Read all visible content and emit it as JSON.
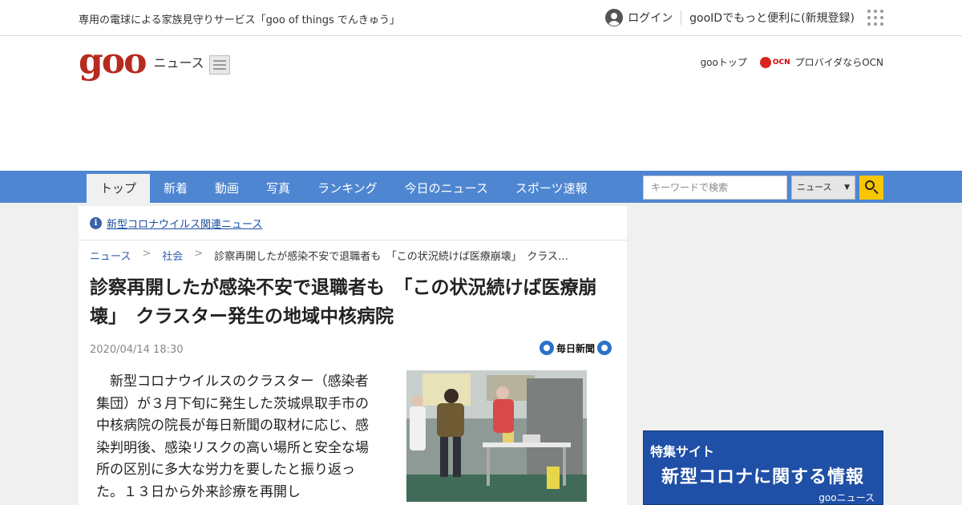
{
  "topbar": {
    "promo": "専用の電球による家族見守りサービス「goo of things でんきゅう」",
    "login": "ログイン",
    "register": "gooIDでもっと便利に(新規登録)"
  },
  "header": {
    "logo": "goo",
    "section": "ニュース",
    "links": {
      "goo_top": "gooトップ",
      "ocn_badge": "OCN",
      "ocn": "プロバイダならOCN"
    }
  },
  "nav": {
    "tabs": [
      "トップ",
      "新着",
      "動画",
      "写真",
      "ランキング",
      "今日のニュース",
      "スポーツ速報"
    ],
    "search_placeholder": "キーワードで検索",
    "search_scope": "ニュース"
  },
  "article": {
    "notice": "新型コロナウイルス関連ニュース",
    "breadcrumb": [
      "ニュース",
      "社会",
      "診察再開したが感染不安で退職者も　「この状況続けば医療崩壊」　クラス…"
    ],
    "title": "診察再開したが感染不安で退職者も　「この状況続けば医療崩壊」　クラスター発生の地域中核病院",
    "date": "2020/04/14 18:30",
    "source": "毎日新聞",
    "body": "新型コロナウイルスのクラスター（感染者集団）が３月下旬に発生した茨城県取手市の中核病院の院長が毎日新聞の取材に応じ、感染判明後、感染リスクの高い場所と安全な場所の区別に多大な労力を要したと振り返った。１３日から外来診療を再開し"
  },
  "banner": {
    "tag": "特集サイト",
    "title": "新型コロナに関する情報",
    "footer": "gooニュース"
  }
}
